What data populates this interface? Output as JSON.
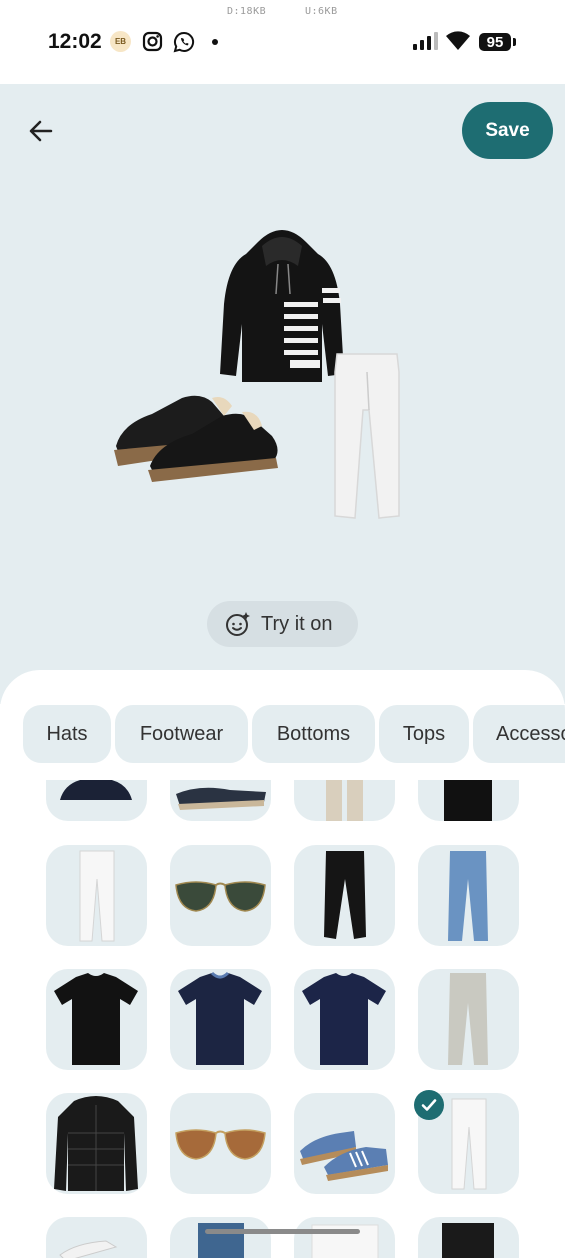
{
  "status_bar": {
    "time": "12:02",
    "download_rate": "D:18KB",
    "upload_rate": "U:6KB",
    "notification_badge": "EB",
    "battery_level": "95"
  },
  "header": {
    "save_label": "Save"
  },
  "outfit": {
    "items": [
      "hoodie",
      "sneakers",
      "white-jeans"
    ]
  },
  "try_on_label": "Try it on",
  "categories": [
    "Hats",
    "Footwear",
    "Bottoms",
    "Tops",
    "Accessories"
  ],
  "wardrobe_items": [
    "navy-cap",
    "navy-loafers",
    "beige-chinos",
    "black-shirt",
    "white-jeans",
    "aviator-sunglasses-green",
    "black-joggers",
    "blue-jeans",
    "black-tshirt",
    "navy-tshirt",
    "navy-crew-tshirt",
    "grey-jeans",
    "black-puffer-jacket",
    "aviator-sunglasses-brown",
    "blue-sneakers",
    "white-jeans-selected",
    "white-sneakers",
    "blue-jeans-2",
    "white-hoodie",
    "black-jeans"
  ],
  "selected_item": "white-jeans-selected",
  "colors": {
    "accent": "#1e6d72",
    "canvas_bg": "#e4edf0"
  }
}
